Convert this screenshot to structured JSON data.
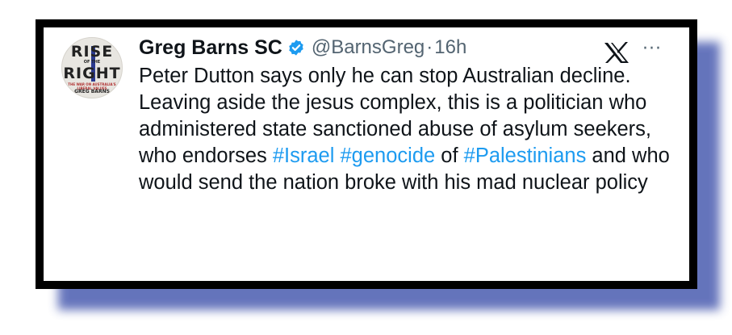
{
  "tweet": {
    "author_name": "Greg Barns SC",
    "handle": "@BarnsGreg",
    "separator": "·",
    "time": "16h",
    "more_label": "···",
    "avatar": {
      "line1": "RISE",
      "line2": "OF THE",
      "line3": "RIGHT",
      "line4": "THE WAR ON AUSTRALIA'S LIBERAL VALUES",
      "line5": "GREG BARNS"
    },
    "segments": [
      {
        "text": "Peter Dutton says only he can stop Australian decline. Leaving aside the jesus complex, this is a politician who administered state sanctioned abuse of asylum seekers, who endorses ",
        "type": "text"
      },
      {
        "text": "#Israel",
        "type": "hashtag"
      },
      {
        "text": " ",
        "type": "text"
      },
      {
        "text": "#genocide",
        "type": "hashtag"
      },
      {
        "text": " of ",
        "type": "text"
      },
      {
        "text": "#Palestinians",
        "type": "hashtag"
      },
      {
        "text": " and who would send the nation broke with his mad nuclear policy",
        "type": "text"
      }
    ]
  },
  "colors": {
    "hashtag": "#1d9bf0",
    "verified_badge": "#1d9bf0",
    "frame_border": "#000000",
    "shadow": "#4a5cb0"
  },
  "icons": {
    "verified": "verified-badge-icon",
    "x_logo": "x-logo-icon",
    "more": "more-options-icon"
  }
}
